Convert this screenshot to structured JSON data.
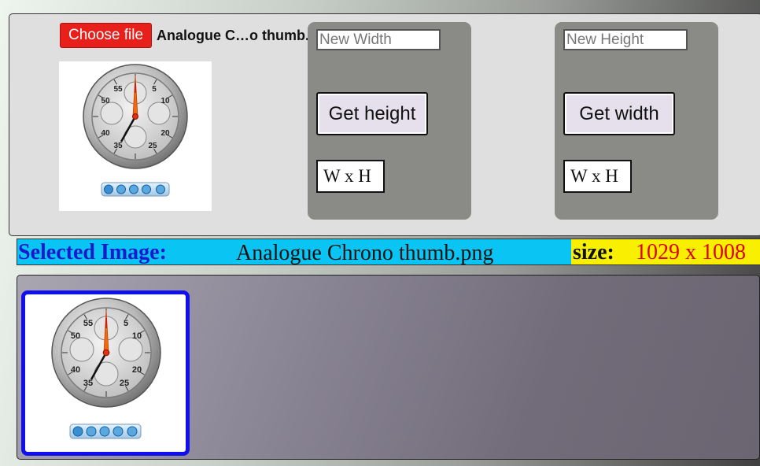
{
  "file_input": {
    "button_label": "Choose file",
    "selected_file_display": "Analogue C…o thumb.png"
  },
  "width_panel": {
    "input_placeholder": "New Width",
    "input_value": "",
    "button_label": "Get height",
    "result": "W x H"
  },
  "height_panel": {
    "input_placeholder": "New Height",
    "input_value": "",
    "button_label": "Get width",
    "result": "W x H"
  },
  "info_bar": {
    "label": "Selected Image:",
    "filename": "Analogue Chrono thumb.png",
    "size_label": "size:",
    "size_value": "1029 x 1008"
  },
  "stopwatch_dial": {
    "numbers": [
      "55",
      "5",
      "50",
      "10",
      "40",
      "20",
      "35",
      "25"
    ]
  },
  "colors": {
    "choose_button": "#e8201c",
    "info_bar_bg": "#0ac4f3",
    "info_label": "#1a1acc",
    "size_bg": "#f8f000",
    "size_value": "#e00000",
    "selected_border": "#1010ee",
    "control_panel_bg": "#8a8b86"
  }
}
